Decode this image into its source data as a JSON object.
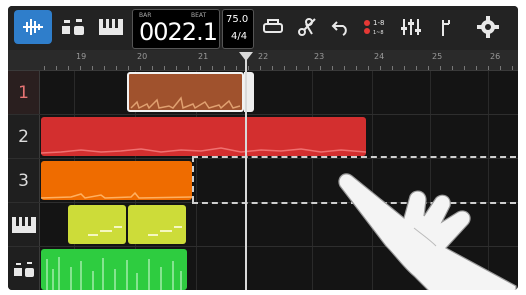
{
  "toolbar": {
    "counter_label_bar": "BAR",
    "counter_label_beat": "BEAT",
    "counter_value": "0022.1",
    "tempo_bpm": "75.0",
    "time_signature": "4/4",
    "icons": [
      "waveform-icon",
      "drum-kit-icon",
      "keyboard-icon",
      "printer-icon",
      "scissors-icon",
      "undo-icon",
      "track-range-icon",
      "mixer-icon",
      "tuning-fork-icon",
      "settings-icon"
    ],
    "accent_color": "#2f7ecb"
  },
  "ruler": {
    "labels": [
      "19",
      "20",
      "21",
      "22",
      "23",
      "24",
      "25",
      "26"
    ]
  },
  "tracks": [
    {
      "label": "1",
      "clip_color": "#a0522d",
      "selected": true
    },
    {
      "label": "2",
      "clip_color": "#d32f2f"
    },
    {
      "label": "3",
      "clip_color": "#ef6c00"
    },
    {
      "label": "",
      "clip_color": "#cddc39",
      "icon": "keyboard-icon"
    },
    {
      "label": "",
      "clip_color": "#2ecc40",
      "icon": "drum-kit-icon"
    }
  ]
}
